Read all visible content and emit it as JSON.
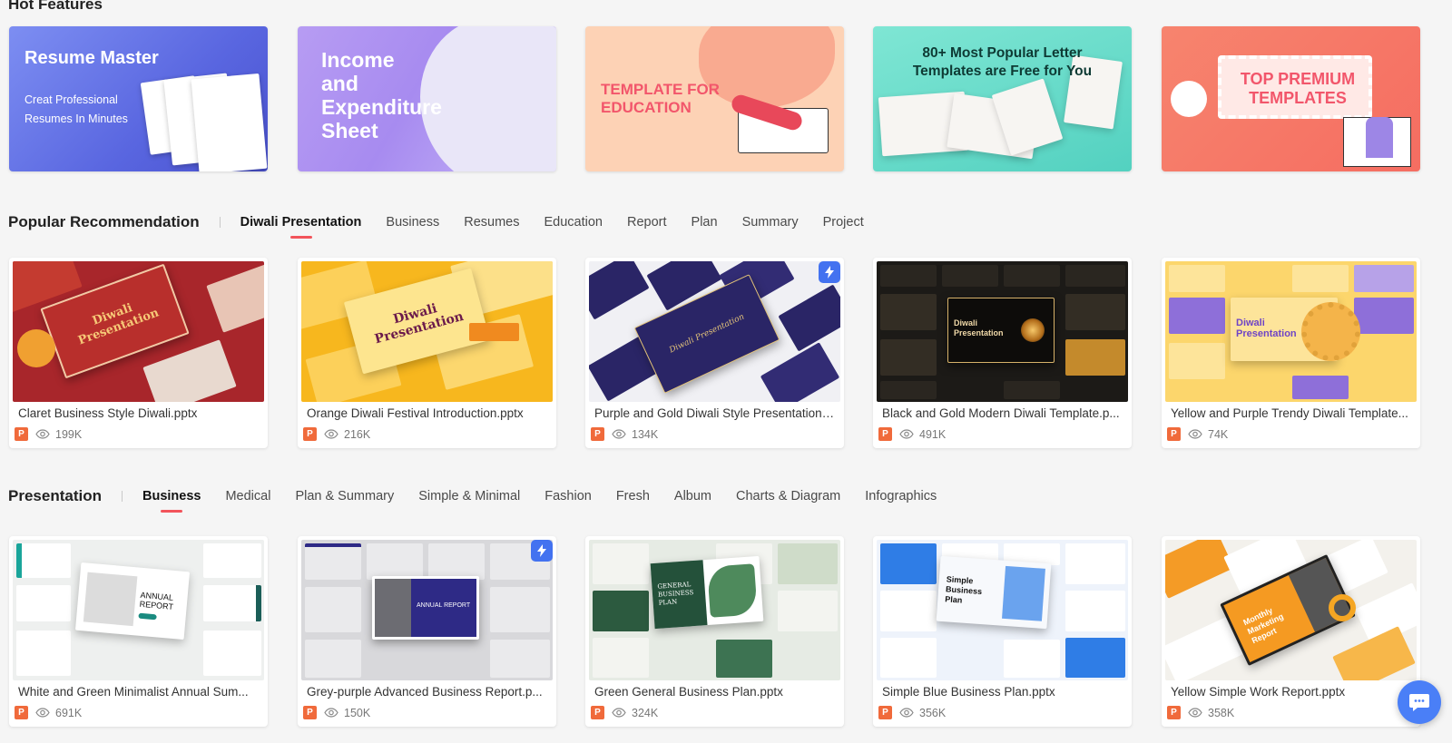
{
  "hot_features": {
    "title": "Hot Features",
    "banners": [
      {
        "line1": "Resume Master",
        "line2": "Creat Professional",
        "line3": "Resumes In Minutes"
      },
      {
        "text": "Income\nand\nExpenditure\nSheet"
      },
      {
        "text": "TEMPLATE FOR\nEDUCATION"
      },
      {
        "text": "80+ Most Popular Letter\nTemplates are Free for You"
      },
      {
        "text": "TOP PREMIUM\nTEMPLATES"
      }
    ]
  },
  "popular": {
    "title": "Popular Recommendation",
    "tabs": [
      "Diwali Presentation",
      "Business",
      "Resumes",
      "Education",
      "Report",
      "Plan",
      "Summary",
      "Project"
    ],
    "active_tab": 0,
    "cards": [
      {
        "name": "Claret Business Style Diwali.pptx",
        "views": "199K",
        "thumb_text": "Diwali Presentation",
        "premium": false
      },
      {
        "name": "Orange Diwali Festival Introduction.pptx",
        "views": "216K",
        "thumb_text": "Diwali Presentation",
        "premium": false
      },
      {
        "name": "Purple and Gold Diwali Style Presentation....",
        "views": "134K",
        "thumb_text": "Diwali Presentation",
        "premium": true
      },
      {
        "name": "Black and Gold Modern Diwali Template.p...",
        "views": "491K",
        "thumb_text": "Diwali Presentation",
        "premium": false
      },
      {
        "name": "Yellow and Purple Trendy Diwali Template...",
        "views": "74K",
        "thumb_text": "Diwali Presentation",
        "premium": false
      }
    ]
  },
  "presentation": {
    "title": "Presentation",
    "tabs": [
      "Business",
      "Medical",
      "Plan & Summary",
      "Simple & Minimal",
      "Fashion",
      "Fresh",
      "Album",
      "Charts & Diagram",
      "Infographics"
    ],
    "active_tab": 0,
    "cards": [
      {
        "name": "White and Green Minimalist Annual Sum...",
        "views": "691K",
        "thumb_text": "ANNUAL REPORT",
        "premium": false
      },
      {
        "name": "Grey-purple Advanced Business Report.p...",
        "views": "150K",
        "thumb_text": "ANNUAL REPORT",
        "premium": true
      },
      {
        "name": "Green General Business Plan.pptx",
        "views": "324K",
        "thumb_text": "GENERAL BUSINESS PLAN",
        "premium": false
      },
      {
        "name": "Simple Blue Business Plan.pptx",
        "views": "356K",
        "thumb_text": "Simple Business Plan",
        "premium": false
      },
      {
        "name": "Yellow Simple Work Report.pptx",
        "views": "358K",
        "thumb_text": "Monthly Marketing Report",
        "premium": false
      }
    ]
  },
  "colors": {
    "accent": "#f2545b",
    "ppt_icon": "#f06a3b",
    "premium_badge": "#4372f0",
    "chat_button": "#4a7ff7"
  },
  "icons": {
    "views": "eye-icon",
    "file_type": "ppt-icon",
    "premium": "lightning-icon",
    "chat": "chat-icon"
  }
}
